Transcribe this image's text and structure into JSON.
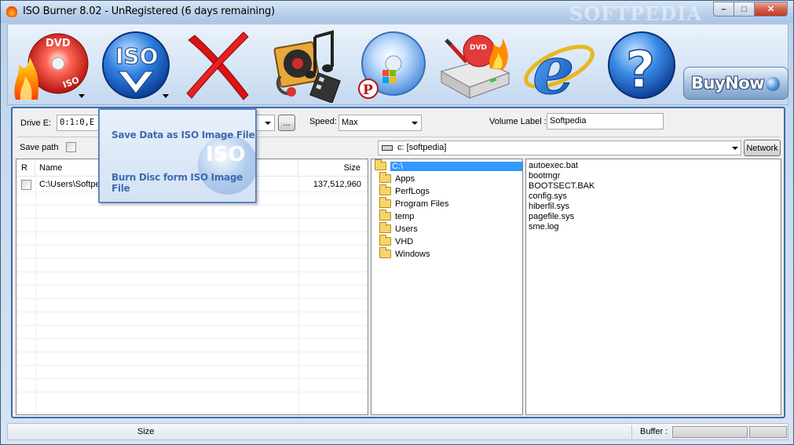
{
  "window": {
    "title": "ISO Burner 8.02 - UnRegistered (6 days remaining)",
    "watermark": "SOFTPEDIA",
    "controls": {
      "minimize": "–",
      "maximize": "□",
      "close": "✕"
    }
  },
  "toolbar": {
    "buttons": [
      {
        "id": "burn-dvd",
        "icon": "flaming-dvd-iso-icon",
        "has_dropdown": true
      },
      {
        "id": "iso-menu",
        "icon": "iso-disc-icon",
        "label": "ISO",
        "has_dropdown": true
      },
      {
        "id": "erase",
        "icon": "red-x-icon",
        "has_dropdown": false
      },
      {
        "id": "audio",
        "icon": "music-media-icon",
        "has_dropdown": false
      },
      {
        "id": "vista-disc",
        "icon": "windows-disc-icon",
        "has_dropdown": false
      },
      {
        "id": "disc-drive",
        "icon": "dvd-drive-flame-icon",
        "has_dropdown": false
      },
      {
        "id": "internet",
        "icon": "internet-explorer-icon",
        "has_dropdown": false
      },
      {
        "id": "help",
        "icon": "help-icon",
        "label": "?",
        "has_dropdown": false
      }
    ],
    "buy_now_label": "BuyNow"
  },
  "options": {
    "drive_label": "Drive E:",
    "drive_value": "0:1:0,E",
    "browse_label": "...",
    "speed_label": "Speed:",
    "speed_value": "Max",
    "volume_label": "Volume Label :",
    "volume_value": "Softpedia",
    "save_path_label": "Save path"
  },
  "left_list": {
    "columns": [
      "R",
      "Name",
      "Size"
    ],
    "rows": [
      {
        "checked": false,
        "name": "C:\\Users\\Softpe",
        "size": "137,512,960"
      }
    ]
  },
  "right_panel": {
    "drive_value": "c: [softpedia]",
    "network_label": "Network",
    "folders": [
      {
        "name": "C:\\",
        "selected": true
      },
      {
        "name": "Apps",
        "selected": false
      },
      {
        "name": "PerfLogs",
        "selected": false
      },
      {
        "name": "Program Files",
        "selected": false
      },
      {
        "name": "temp",
        "selected": false
      },
      {
        "name": "Users",
        "selected": false
      },
      {
        "name": "VHD",
        "selected": false
      },
      {
        "name": "Windows",
        "selected": false
      }
    ],
    "files": [
      "autoexec.bat",
      "bootmgr",
      "BOOTSECT.BAK",
      "config.sys",
      "hiberfil.sys",
      "pagefile.sys",
      "sme.log"
    ]
  },
  "popup_menu": {
    "items": [
      "Save Data as ISO Image File",
      "Burn Disc form ISO Image File"
    ],
    "watermark_text": "ISO"
  },
  "status": {
    "size_label": "Size",
    "buffer_label": "Buffer :"
  },
  "colors": {
    "frame_border": "#3e6ab0",
    "popup_text": "#3e6cae",
    "selection": "#3399ff"
  }
}
